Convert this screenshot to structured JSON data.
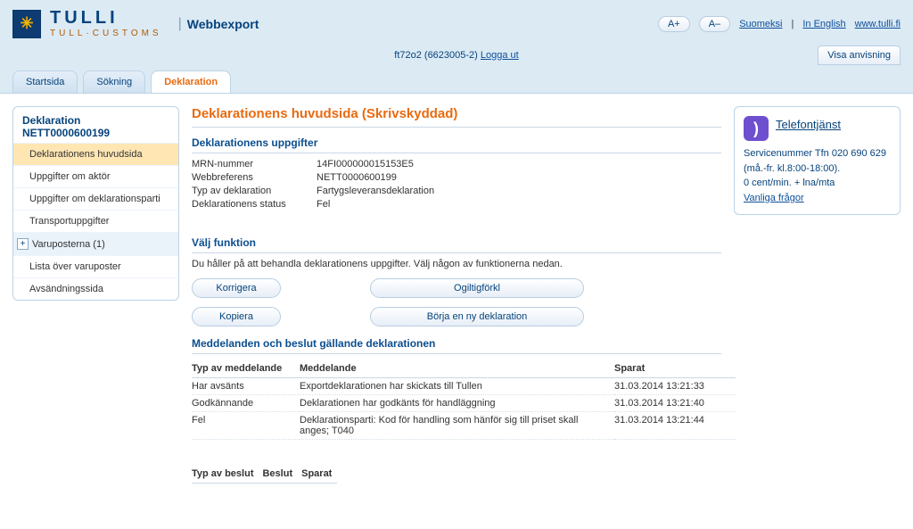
{
  "header": {
    "brand_main": "TULLI",
    "brand_sub": "TULL·CUSTOMS",
    "app_title": "Webbexport",
    "zoom_in": "A+",
    "zoom_out": "A–",
    "lang_fi": "Suomeksi",
    "lang_en": "In English",
    "site_link": "www.tulli.fi",
    "user_info": "ft72o2 (6623005-2)",
    "logout": "Logga ut",
    "show_instructions": "Visa anvisning"
  },
  "tabs": {
    "start": "Startsida",
    "search": "Sökning",
    "decl": "Deklaration"
  },
  "sidebar": {
    "title_prefix": "Deklaration",
    "ref": "NETT0000600199",
    "items": {
      "main": "Deklarationens huvudsida",
      "actor": "Uppgifter om aktör",
      "party": "Uppgifter om deklarationsparti",
      "transport": "Transportuppgifter",
      "goods": "Varuposterna (1)",
      "goodslist": "Lista över varuposter",
      "sendpage": "Avsändningssida"
    }
  },
  "main": {
    "title": "Deklarationens huvudsida  (Skrivskyddad)",
    "info_heading": "Deklarationens uppgifter",
    "labels": {
      "mrn": "MRN-nummer",
      "webref": "Webbreferens",
      "type": "Typ av deklaration",
      "status": "Deklarationens status"
    },
    "values": {
      "mrn": "14FI000000015153E5",
      "webref": "NETT0000600199",
      "type": "Fartygsleveransdeklaration",
      "status": "Fel"
    },
    "fn_heading": "Välj funktion",
    "fn_instruction": "Du håller på att behandla deklarationens uppgifter. Välj någon av funktionerna nedan.",
    "buttons": {
      "correct": "Korrigera",
      "invalidate": "Ogiltigförkl",
      "copy": "Kopiera",
      "new": "Börja en ny deklaration"
    },
    "msg_heading": "Meddelanden och beslut gällande deklarationen",
    "msg_headers": {
      "type": "Typ av meddelande",
      "msg": "Meddelande",
      "saved": "Sparat"
    },
    "messages": [
      {
        "type": "Har avsänts",
        "msg": "Exportdeklarationen har skickats till Tullen",
        "saved": "31.03.2014 13:21:33"
      },
      {
        "type": "Godkännande",
        "msg": "Deklarationen har godkänts för handläggning",
        "saved": "31.03.2014 13:21:40"
      },
      {
        "type": "Fel",
        "msg": "Deklarationsparti: Kod för handling som hänför sig till priset skall anges; T040",
        "saved": "31.03.2014 13:21:44"
      }
    ],
    "dec_headers": {
      "type": "Typ av beslut",
      "dec": "Beslut",
      "saved": "Sparat"
    }
  },
  "right": {
    "title": "Telefontjänst",
    "line1": "Servicenummer Tfn 020 690 629 (må.-fr. kl.8:00-18:00).",
    "line2": "0 cent/min. + lna/mta",
    "faq": "Vanliga frågor"
  }
}
